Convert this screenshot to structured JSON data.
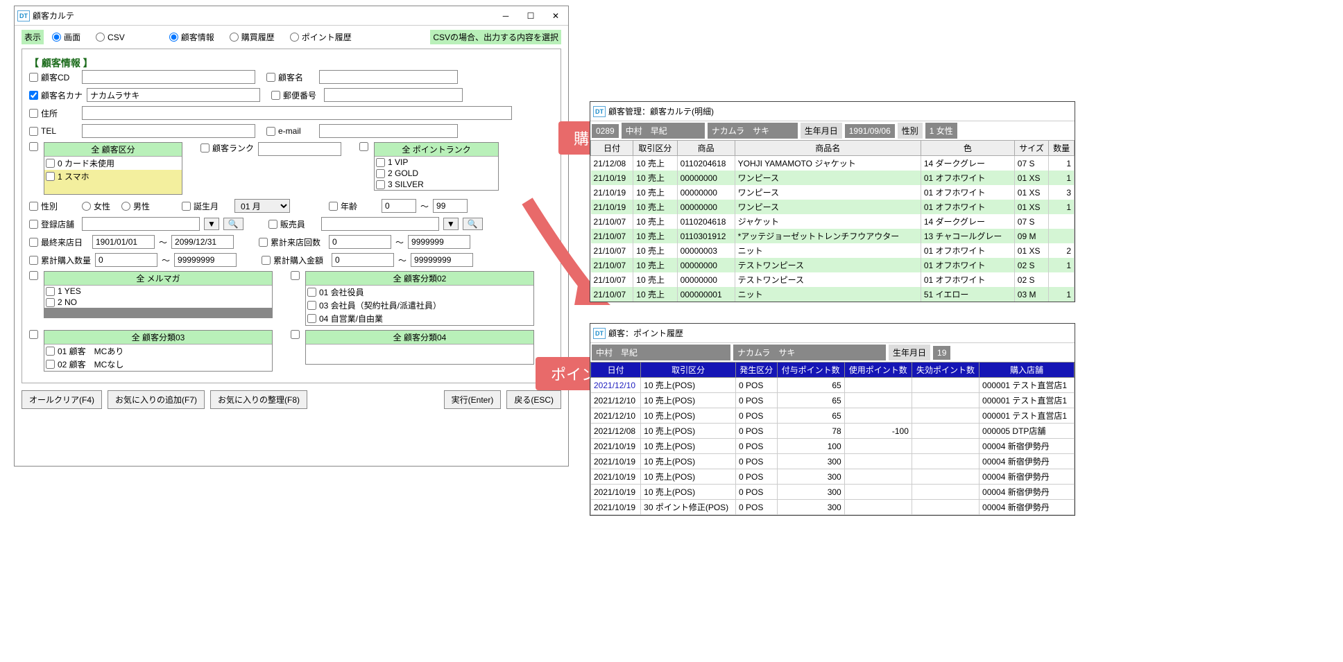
{
  "main": {
    "title": "顧客カルテ",
    "display_label": "表示",
    "display_opts": [
      "画面",
      "CSV"
    ],
    "output_opts": [
      "顧客情報",
      "購買履歴",
      "ポイント履歴"
    ],
    "csv_note": "CSVの場合、出力する内容を選択",
    "section_title": "【 顧客情報 】",
    "customer_cd": "顧客CD",
    "customer_name": "顧客名",
    "customer_kana": "顧客名カナ",
    "kana_value": "ナカムラサキ",
    "postal": "郵便番号",
    "address": "住所",
    "tel": "TEL",
    "email": "e-mail",
    "all": "全",
    "cust_class": "顧客区分",
    "cust_class_items": [
      "0 カード未使用",
      "1 スマホ"
    ],
    "cust_rank": "顧客ランク",
    "point_rank": "ポイントランク",
    "point_rank_items": [
      "1 VIP",
      "2 GOLD",
      "3 SILVER"
    ],
    "gender": "性別",
    "gender_opts": [
      "女性",
      "男性"
    ],
    "birth_month": "誕生月",
    "birth_month_val": "01 月",
    "age": "年齢",
    "age_from": "0",
    "age_to": "99",
    "reg_store": "登録店舗",
    "salesperson": "販売員",
    "last_visit": "最終来店日",
    "lv_from": "1901/01/01",
    "lv_to": "2099/12/31",
    "visit_count": "累計来店回数",
    "vc_from": "0",
    "vc_to": "9999999",
    "purch_qty": "累計購入数量",
    "pq_from": "0",
    "pq_to": "99999999",
    "purch_amt": "累計購入金額",
    "pa_from": "0",
    "pa_to": "99999999",
    "range_sep": "～",
    "mailmag": "メルマガ",
    "mailmag_items": [
      "1 YES",
      "2 NO"
    ],
    "class02": "顧客分類02",
    "class02_items": [
      "01 会社役員",
      "03 会社員（契約社員/派遣社員）",
      "04 自営業/自由業"
    ],
    "class03": "顧客分類03",
    "class03_items": [
      "01 顧客　MCあり",
      "02 顧客　MCなし"
    ],
    "class04": "顧客分類04",
    "btn_clear": "オールクリア(F4)",
    "btn_fav_add": "お気に入りの追加(F7)",
    "btn_fav_org": "お気に入りの整理(F8)",
    "btn_exec": "実行(Enter)",
    "btn_back": "戻る(ESC)"
  },
  "callouts": {
    "purchase": "購入履歴",
    "points": "ポイント履歴"
  },
  "detail": {
    "title": "顧客管理：顧客カルテ(明細)",
    "cust_code": "0289",
    "cust_name": "中村　早紀",
    "cust_kana": "ナカムラ　サキ",
    "birth_label": "生年月日",
    "birth": "1991/09/06",
    "gender_label": "性別",
    "gender": "1 女性",
    "headers": [
      "日付",
      "取引区分",
      "商品",
      "商品名",
      "色",
      "サイズ",
      "数量"
    ],
    "rows": [
      {
        "d": "21/12/08",
        "t": "10 売上",
        "c": "0110204618",
        "n": "YOHJI YAMAMOTO ジャケット",
        "col": "14 ダークグレー",
        "s": "07 S",
        "q": "1",
        "alt": false
      },
      {
        "d": "21/10/19",
        "t": "10 売上",
        "c": "00000000",
        "n": "ワンピース",
        "col": "01 オフホワイト",
        "s": "01 XS",
        "q": "1",
        "alt": true
      },
      {
        "d": "21/10/19",
        "t": "10 売上",
        "c": "00000000",
        "n": "ワンピース",
        "col": "01 オフホワイト",
        "s": "01 XS",
        "q": "3",
        "alt": false
      },
      {
        "d": "21/10/19",
        "t": "10 売上",
        "c": "00000000",
        "n": "ワンピース",
        "col": "01 オフホワイト",
        "s": "01 XS",
        "q": "1",
        "alt": true
      },
      {
        "d": "21/10/07",
        "t": "10 売上",
        "c": "0110204618",
        "n": "ジャケット",
        "col": "14 ダークグレー",
        "s": "07 S",
        "q": "",
        "alt": false
      },
      {
        "d": "21/10/07",
        "t": "10 売上",
        "c": "0110301912",
        "n": "*アッテジョーゼットトレンチフウアウター",
        "col": "13 チャコールグレー",
        "s": "09 M",
        "q": "",
        "alt": true
      },
      {
        "d": "21/10/07",
        "t": "10 売上",
        "c": "00000003",
        "n": "ニット",
        "col": "01 オフホワイト",
        "s": "01 XS",
        "q": "2",
        "alt": false
      },
      {
        "d": "21/10/07",
        "t": "10 売上",
        "c": "00000000",
        "n": "テストワンピース",
        "col": "01 オフホワイト",
        "s": "02 S",
        "q": "1",
        "alt": true
      },
      {
        "d": "21/10/07",
        "t": "10 売上",
        "c": "00000000",
        "n": "テストワンピース",
        "col": "01 オフホワイト",
        "s": "02 S",
        "q": "",
        "alt": false
      },
      {
        "d": "21/10/07",
        "t": "10 売上",
        "c": "000000001",
        "n": "ニット",
        "col": "51 イエロー",
        "s": "03 M",
        "q": "1",
        "alt": true
      }
    ]
  },
  "points": {
    "title": "顧客：ポイント履歴",
    "cust_name": "中村　早紀",
    "cust_kana": "ナカムラ　サキ",
    "birth_label": "生年月日",
    "birth_trunc": "19",
    "headers": [
      "日付",
      "取引区分",
      "発生区分",
      "付与ポイント数",
      "使用ポイント数",
      "失効ポイント数",
      "購入店舗"
    ],
    "rows": [
      {
        "d": "2021/12/10",
        "t": "10 売上(POS)",
        "o": "0 POS",
        "g": "65",
        "u": "",
        "e": "",
        "s": "000001 テスト直営店1",
        "hl": true
      },
      {
        "d": "2021/12/10",
        "t": "10 売上(POS)",
        "o": "0 POS",
        "g": "65",
        "u": "",
        "e": "",
        "s": "000001 テスト直営店1"
      },
      {
        "d": "2021/12/10",
        "t": "10 売上(POS)",
        "o": "0 POS",
        "g": "65",
        "u": "",
        "e": "",
        "s": "000001 テスト直営店1"
      },
      {
        "d": "2021/12/08",
        "t": "10 売上(POS)",
        "o": "0 POS",
        "g": "78",
        "u": "-100",
        "e": "",
        "s": "000005 DTP店舗"
      },
      {
        "d": "2021/10/19",
        "t": "10 売上(POS)",
        "o": "0 POS",
        "g": "100",
        "u": "",
        "e": "",
        "s": "00004 新宿伊勢丹"
      },
      {
        "d": "2021/10/19",
        "t": "10 売上(POS)",
        "o": "0 POS",
        "g": "300",
        "u": "",
        "e": "",
        "s": "00004 新宿伊勢丹"
      },
      {
        "d": "2021/10/19",
        "t": "10 売上(POS)",
        "o": "0 POS",
        "g": "300",
        "u": "",
        "e": "",
        "s": "00004 新宿伊勢丹"
      },
      {
        "d": "2021/10/19",
        "t": "10 売上(POS)",
        "o": "0 POS",
        "g": "300",
        "u": "",
        "e": "",
        "s": "00004 新宿伊勢丹"
      },
      {
        "d": "2021/10/19",
        "t": "30 ポイント修正(POS)",
        "o": "0 POS",
        "g": "300",
        "u": "",
        "e": "",
        "s": "00004 新宿伊勢丹"
      }
    ]
  }
}
